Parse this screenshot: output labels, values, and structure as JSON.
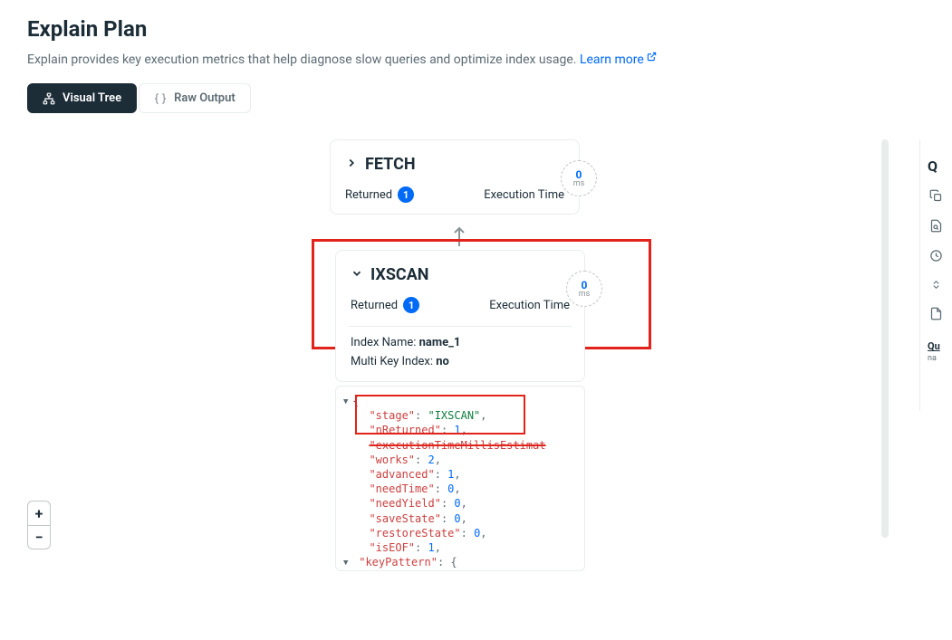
{
  "header": {
    "title": "Explain Plan",
    "subtitle_prefix": "Explain provides key execution metrics that help diagnose slow queries and optimize index usage. ",
    "learn_more": "Learn more"
  },
  "tabs": {
    "visual": "Visual Tree",
    "raw": "Raw Output"
  },
  "fetch_node": {
    "title": "FETCH",
    "returned_label": "Returned",
    "returned_count": "1",
    "exec_label": "Execution Time",
    "clock_value": "0",
    "clock_unit": "ms"
  },
  "ixscan_node": {
    "title": "IXSCAN",
    "returned_label": "Returned",
    "returned_count": "1",
    "exec_label": "Execution Time",
    "clock_value": "0",
    "clock_unit": "ms",
    "index_name_label": "Index Name: ",
    "index_name_value": "name_1",
    "multi_key_label": "Multi Key Index: ",
    "multi_key_value": "no"
  },
  "code": {
    "stage_key": "\"stage\"",
    "stage_val": "\"IXSCAN\"",
    "nreturned_key": "\"nReturned\"",
    "nreturned_val": "1",
    "exec_struck": "\"executionTimeMillisEstimat",
    "works_key": "\"works\"",
    "works_val": "2",
    "advanced_key": "\"advanced\"",
    "advanced_val": "1",
    "needtime_key": "\"needTime\"",
    "needtime_val": "0",
    "needyield_key": "\"needYield\"",
    "needyield_val": "0",
    "savestate_key": "\"saveState\"",
    "savestate_val": "0",
    "restorestate_key": "\"restoreState\"",
    "restorestate_val": "0",
    "iseof_key": "\"isEOF\"",
    "iseof_val": "1",
    "keypattern_key": "\"keyPattern\"",
    "brace_open": "{",
    "brace_close": "}"
  },
  "zoom": {
    "plus": "+",
    "minus": "−"
  },
  "right_panel": {
    "head": "Q",
    "label": "Qu",
    "pill": "na"
  }
}
